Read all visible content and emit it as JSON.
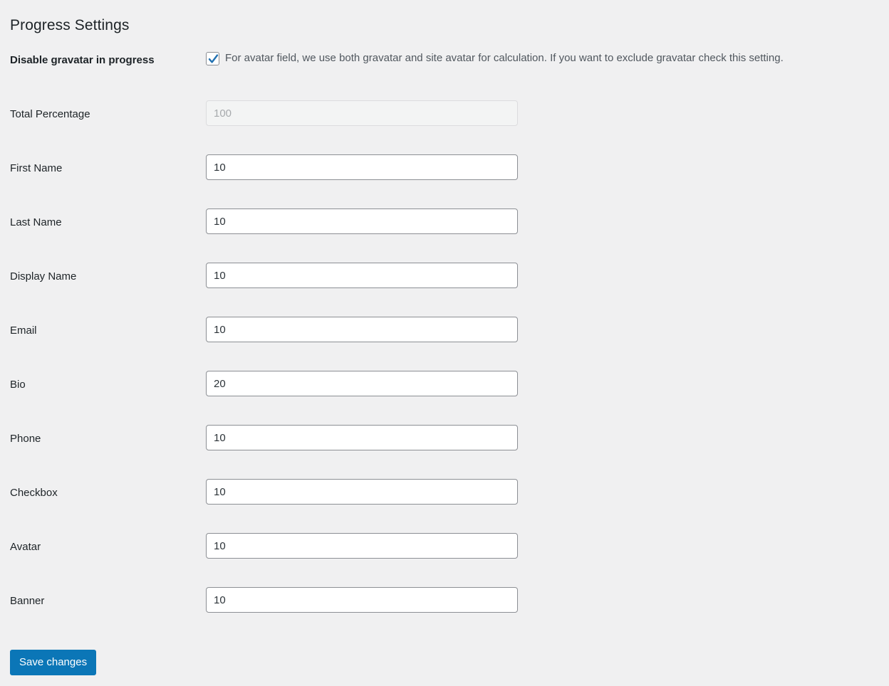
{
  "page": {
    "title": "Progress Settings"
  },
  "gravatar_setting": {
    "label": "Disable gravatar in progress",
    "checked": true,
    "description": "For avatar field, we use both gravatar and site avatar for calculation. If you want to exclude gravatar check this setting."
  },
  "fields": [
    {
      "label": "Total Percentage",
      "value": "100",
      "disabled": true
    },
    {
      "label": "First Name",
      "value": "10",
      "disabled": false
    },
    {
      "label": "Last Name",
      "value": "10",
      "disabled": false
    },
    {
      "label": "Display Name",
      "value": "10",
      "disabled": false
    },
    {
      "label": "Email",
      "value": "10",
      "disabled": false
    },
    {
      "label": "Bio",
      "value": "20",
      "disabled": false
    },
    {
      "label": "Phone",
      "value": "10",
      "disabled": false
    },
    {
      "label": "Checkbox",
      "value": "10",
      "disabled": false
    },
    {
      "label": "Avatar",
      "value": "10",
      "disabled": false
    },
    {
      "label": "Banner",
      "value": "10",
      "disabled": false
    }
  ],
  "submit": {
    "label": "Save changes"
  },
  "colors": {
    "accent": "#0b76b7",
    "background": "#f0f0f1",
    "text": "#1d2327",
    "muted_text": "#50575e",
    "checkbox_check": "#2271b1",
    "input_border": "#8c8f94",
    "disabled_bg": "#f3f4f4"
  },
  "icons": {
    "checkmark": "checkmark-icon"
  }
}
